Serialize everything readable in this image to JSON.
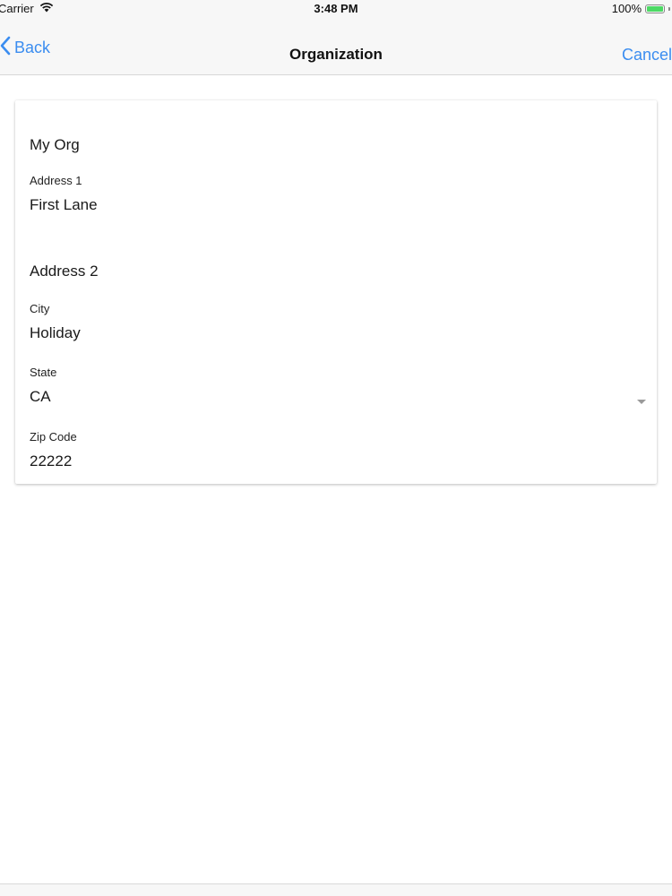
{
  "status_bar": {
    "carrier": "Carrier",
    "time": "3:48 PM",
    "battery": "100%",
    "battery_level": 1.0
  },
  "nav_bar": {
    "back_label": "Back",
    "title": "Organization",
    "cancel_label": "Cancel"
  },
  "form": {
    "org_name": "My Org",
    "address1": {
      "label": "Address 1",
      "value": "First Lane"
    },
    "address2": {
      "placeholder": "Address 2"
    },
    "city": {
      "label": "City",
      "value": "Holiday"
    },
    "state": {
      "label": "State",
      "value": "CA"
    },
    "zip": {
      "label": "Zip Code",
      "value": "22222"
    }
  },
  "colors": {
    "accent": "#3b8df0",
    "battery": "#4cd964",
    "nav_background": "#f7f7f7"
  },
  "icons": {
    "status": [
      "wifi-icon",
      "battery-icon"
    ],
    "nav": [
      "chevron-left-icon"
    ],
    "form": [
      "dropdown-caret-icon"
    ]
  }
}
